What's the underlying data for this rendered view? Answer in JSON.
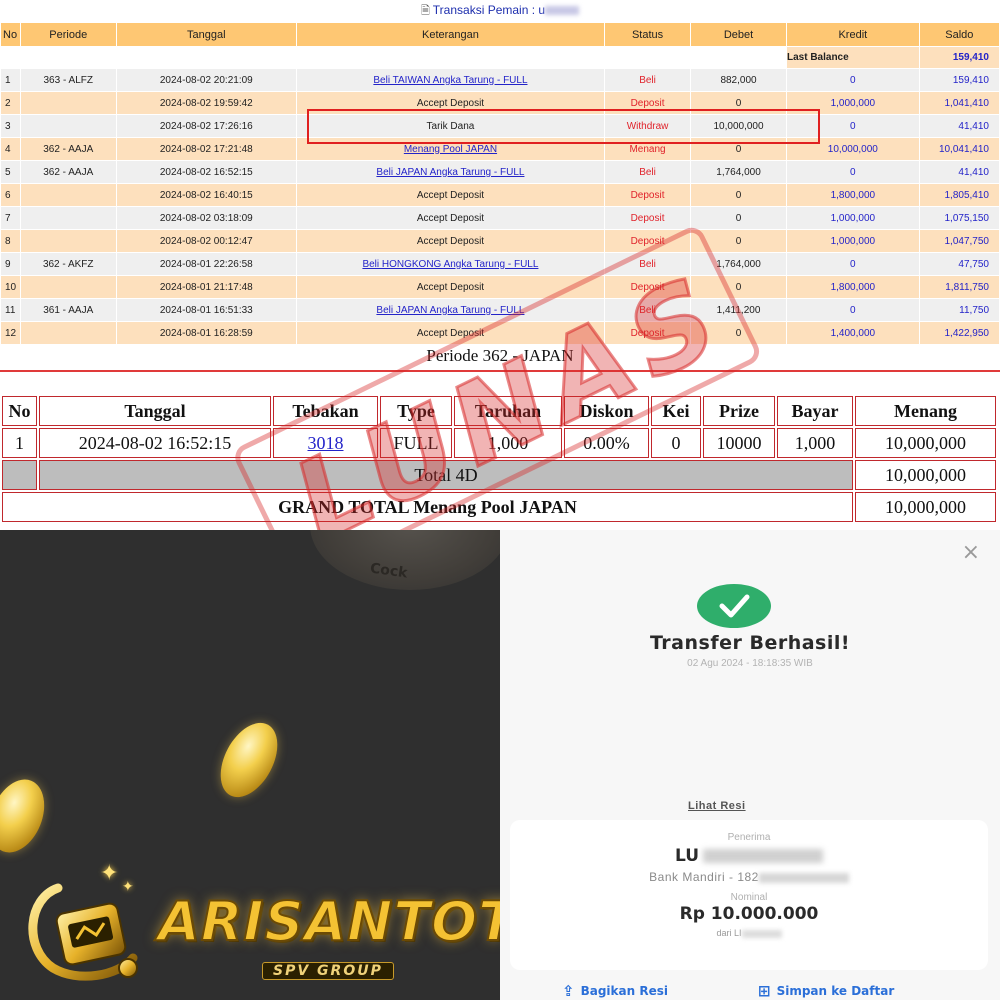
{
  "transactions": {
    "title": "Transaksi  Pemain : u",
    "headers": [
      "No",
      "Periode",
      "Tanggal",
      "Keterangan",
      "Status",
      "Debet",
      "Kredit",
      "Saldo"
    ],
    "last_balance_label": "Last Balance",
    "last_balance_value": "159,410",
    "rows": [
      {
        "no": "1",
        "periode": "363 - ALFZ",
        "tanggal": "2024-08-02 20:21:09",
        "keterangan": "Beli TAIWAN Angka Tarung - FULL",
        "status": "Beli",
        "debet": "882,000",
        "kredit": "0",
        "saldo": "159,410"
      },
      {
        "no": "2",
        "periode": "",
        "tanggal": "2024-08-02 19:59:42",
        "keterangan": "Accept Deposit",
        "status": "Deposit",
        "debet": "0",
        "kredit": "1,000,000",
        "saldo": "1,041,410"
      },
      {
        "no": "3",
        "periode": "",
        "tanggal": "2024-08-02 17:26:16",
        "keterangan": "Tarik Dana",
        "status": "Withdraw",
        "debet": "10,000,000",
        "kredit": "0",
        "saldo": "41,410"
      },
      {
        "no": "4",
        "periode": "362 - AAJA",
        "tanggal": "2024-08-02 17:21:48",
        "keterangan": "Menang Pool JAPAN",
        "status": "Menang",
        "debet": "0",
        "kredit": "10,000,000",
        "saldo": "10,041,410"
      },
      {
        "no": "5",
        "periode": "362 - AAJA",
        "tanggal": "2024-08-02 16:52:15",
        "keterangan": "Beli JAPAN Angka Tarung - FULL",
        "status": "Beli",
        "debet": "1,764,000",
        "kredit": "0",
        "saldo": "41,410"
      },
      {
        "no": "6",
        "periode": "",
        "tanggal": "2024-08-02 16:40:15",
        "keterangan": "Accept Deposit",
        "status": "Deposit",
        "debet": "0",
        "kredit": "1,800,000",
        "saldo": "1,805,410"
      },
      {
        "no": "7",
        "periode": "",
        "tanggal": "2024-08-02 03:18:09",
        "keterangan": "Accept Deposit",
        "status": "Deposit",
        "debet": "0",
        "kredit": "1,000,000",
        "saldo": "1,075,150"
      },
      {
        "no": "8",
        "periode": "",
        "tanggal": "2024-08-02 00:12:47",
        "keterangan": "Accept Deposit",
        "status": "Deposit",
        "debet": "0",
        "kredit": "1,000,000",
        "saldo": "1,047,750"
      },
      {
        "no": "9",
        "periode": "362 - AKFZ",
        "tanggal": "2024-08-01 22:26:58",
        "keterangan": "Beli HONGKONG Angka Tarung - FULL",
        "status": "Beli",
        "debet": "1,764,000",
        "kredit": "0",
        "saldo": "47,750"
      },
      {
        "no": "10",
        "periode": "",
        "tanggal": "2024-08-01 21:17:48",
        "keterangan": "Accept Deposit",
        "status": "Deposit",
        "debet": "0",
        "kredit": "1,800,000",
        "saldo": "1,811,750"
      },
      {
        "no": "11",
        "periode": "361 - AAJA",
        "tanggal": "2024-08-01 16:51:33",
        "keterangan": "Beli JAPAN Angka Tarung - FULL",
        "status": "Beli",
        "debet": "1,411,200",
        "kredit": "0",
        "saldo": "11,750"
      },
      {
        "no": "12",
        "periode": "",
        "tanggal": "2024-08-01 16:28:59",
        "keterangan": "Accept Deposit",
        "status": "Deposit",
        "debet": "0",
        "kredit": "1,400,000",
        "saldo": "1,422,950"
      }
    ]
  },
  "periode": {
    "title": "Periode 362 - JAPAN",
    "headers": [
      "No",
      "Tanggal",
      "Tebakan",
      "Type",
      "Taruhan",
      "Diskon",
      "Kei",
      "Prize",
      "Bayar",
      "Menang"
    ],
    "row": {
      "no": "1",
      "tanggal": "2024-08-02 16:52:15",
      "tebakan": "3018",
      "type": "FULL",
      "taruhan": "1,000",
      "diskon": "0.00%",
      "kei": "0",
      "prize": "10000",
      "bayar": "1,000",
      "menang": "10,000,000"
    },
    "total_label": "Total 4D",
    "total_value": "10,000,000",
    "grand_label": "GRAND TOTAL  Menang Pool JAPAN",
    "grand_value": "10,000,000"
  },
  "stamp": {
    "text": "LUNAS"
  },
  "brand": {
    "logo": "ARISANTOTO",
    "sub": "SPV GROUP",
    "wheel_label": "Cock",
    "colors": {
      "gold": "#f4c233",
      "dark_bg": "#2f2f2f"
    }
  },
  "receipt": {
    "close": "×",
    "title": "Transfer Berhasil!",
    "date": "02 Agu 2024 - 18:18:35 WIB",
    "view_receipt": "Lihat Resi",
    "recipient_label": "Penerima",
    "recipient_name": "LU",
    "bank": "Bank Mandiri - 182",
    "nominal_label": "Nominal",
    "amount": "Rp 10.000.000",
    "from": "dari LI",
    "share": "Bagikan Resi",
    "save": "Simpan ke Daftar",
    "colors": {
      "success": "#2fae6b",
      "action": "#2b6fd8"
    }
  }
}
